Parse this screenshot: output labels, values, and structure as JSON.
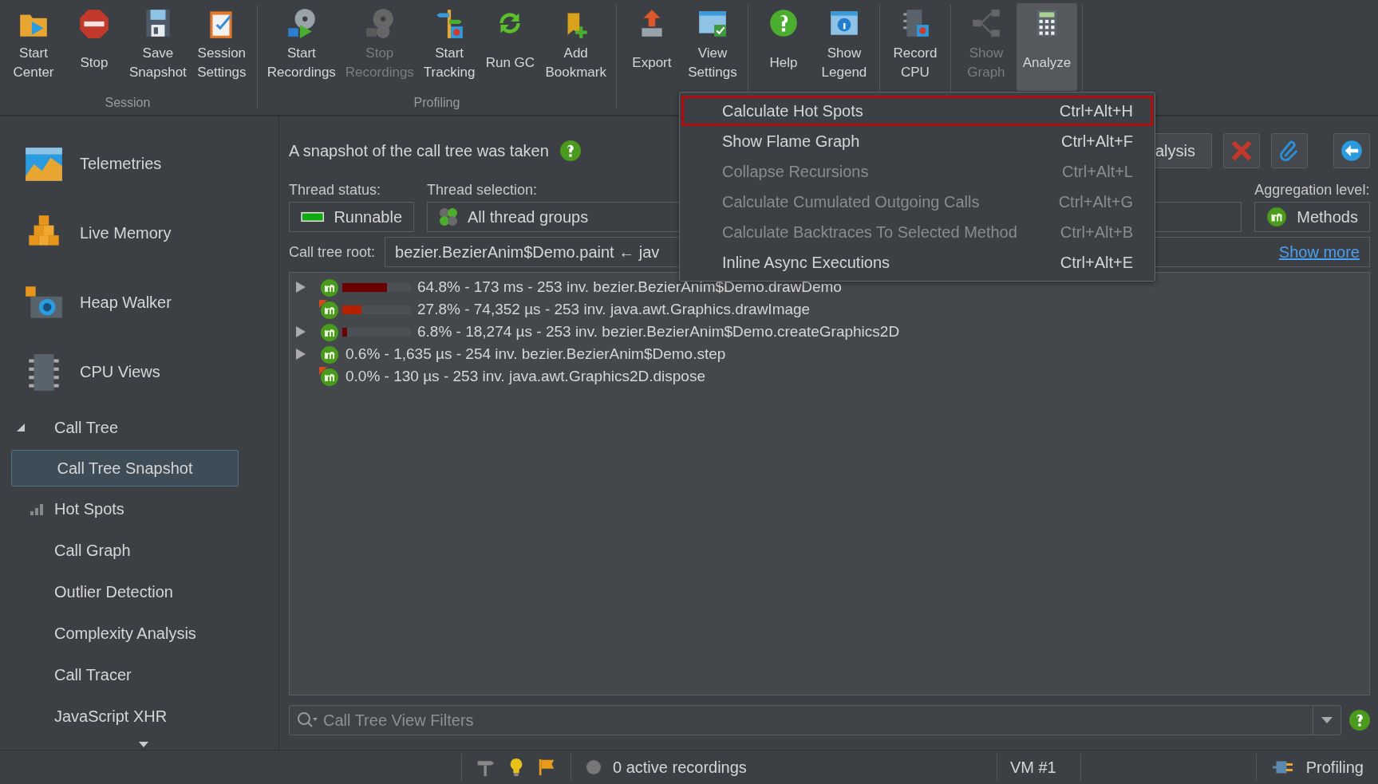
{
  "toolbar": {
    "groups": [
      {
        "label": "Session",
        "buttons": [
          {
            "lines": [
              "Start",
              "Center"
            ],
            "disabled": false,
            "pressed": false
          },
          {
            "lines": [
              "Stop"
            ],
            "disabled": false,
            "pressed": false
          },
          {
            "lines": [
              "Save",
              "Snapshot"
            ],
            "disabled": false,
            "pressed": false
          },
          {
            "lines": [
              "Session",
              "Settings"
            ],
            "disabled": false,
            "pressed": false
          }
        ]
      },
      {
        "label": "Profiling",
        "buttons": [
          {
            "lines": [
              "Start",
              "Recordings"
            ],
            "disabled": false,
            "pressed": false
          },
          {
            "lines": [
              "Stop",
              "Recordings"
            ],
            "disabled": true,
            "pressed": false
          },
          {
            "lines": [
              "Start",
              "Tracking"
            ],
            "disabled": false,
            "pressed": false
          },
          {
            "lines": [
              "Run GC"
            ],
            "disabled": false,
            "pressed": false
          },
          {
            "lines": [
              "Add",
              "Bookmark"
            ],
            "disabled": false,
            "pressed": false
          }
        ]
      },
      {
        "buttons": [
          {
            "lines": [
              "Export"
            ],
            "disabled": false,
            "pressed": false
          },
          {
            "lines": [
              "View",
              "Settings"
            ],
            "disabled": false,
            "pressed": false
          }
        ]
      },
      {
        "buttons": [
          {
            "lines": [
              "Help"
            ],
            "disabled": false,
            "pressed": false
          },
          {
            "lines": [
              "Show",
              "Legend"
            ],
            "disabled": false,
            "pressed": false
          }
        ]
      },
      {
        "buttons": [
          {
            "lines": [
              "Record",
              "CPU"
            ],
            "disabled": false,
            "pressed": false
          }
        ]
      },
      {
        "buttons": [
          {
            "lines": [
              "Show",
              "Graph"
            ],
            "disabled": true,
            "pressed": false
          },
          {
            "lines": [
              "Analyze"
            ],
            "disabled": false,
            "pressed": true
          }
        ]
      }
    ]
  },
  "sidebar": {
    "sections": [
      {
        "label": "Telemetries"
      },
      {
        "label": "Live Memory"
      },
      {
        "label": "Heap Walker"
      },
      {
        "label": "CPU Views"
      }
    ],
    "views": [
      {
        "label": "Call Tree",
        "selected": false,
        "expanded": true,
        "children": [
          {
            "label": "Call Tree Snapshot",
            "selected": true
          }
        ]
      },
      {
        "label": "Hot Spots",
        "selected": false
      },
      {
        "label": "Call Graph",
        "selected": false
      },
      {
        "label": "Outlier Detection",
        "selected": false
      },
      {
        "label": "Complexity Analysis",
        "selected": false
      },
      {
        "label": "Call Tracer",
        "selected": false
      },
      {
        "label": "JavaScript XHR",
        "selected": false
      }
    ]
  },
  "main": {
    "message": "A snapshot of the call tree was taken",
    "analysis_button": "alysis",
    "thread_status": {
      "label": "Thread status:",
      "value": "Runnable"
    },
    "thread_selection": {
      "label": "Thread selection:",
      "value": "All thread groups"
    },
    "aggregation": {
      "label": "Aggregation level:",
      "value": "Methods"
    },
    "call_tree_root": {
      "label": "Call tree root:",
      "value": "bezier.BezierAnim$Demo.paint ← jav",
      "link": "Show more"
    },
    "rows": [
      {
        "text": "64.8% - 173 ms - 253 inv. bezier.BezierAnim$Demo.drawDemo",
        "collapsed": true,
        "marked": false,
        "level": 0.648,
        "color": "#6b0000"
      },
      {
        "text": "27.8% - 74,352 µs - 253 inv. java.awt.Graphics.drawImage",
        "collapsed": false,
        "marked": true,
        "level": 0.278,
        "color": "#b52000"
      },
      {
        "text": "6.8% - 18,274 µs - 253 inv. bezier.BezierAnim$Demo.createGraphics2D",
        "collapsed": true,
        "marked": false,
        "level": 0.068,
        "color": "#6b0000"
      },
      {
        "text": "0.6% - 1,635 µs - 254 inv. bezier.BezierAnim$Demo.step",
        "collapsed": true,
        "marked": false
      },
      {
        "text": "0.0% - 130 µs - 253 inv. java.awt.Graphics2D.dispose",
        "collapsed": false,
        "marked": true
      }
    ],
    "filter": {
      "placeholder": "Call Tree View Filters"
    }
  },
  "menu": [
    {
      "label": "Calculate Hot Spots",
      "shortcut": "Ctrl+Alt+H",
      "disabled": false,
      "selected": true
    },
    {
      "label": "Show Flame Graph",
      "shortcut": "Ctrl+Alt+F",
      "disabled": false,
      "selected": false
    },
    {
      "label": "Collapse Recursions",
      "shortcut": "Ctrl+Alt+L",
      "disabled": true,
      "selected": false
    },
    {
      "label": "Calculate Cumulated Outgoing Calls",
      "shortcut": "Ctrl+Alt+G",
      "disabled": true,
      "selected": false
    },
    {
      "label": "Calculate Backtraces To Selected Method",
      "shortcut": "Ctrl+Alt+B",
      "disabled": true,
      "selected": false
    },
    {
      "label": "Inline Async Executions",
      "shortcut": "Ctrl+Alt+E",
      "disabled": false,
      "selected": false
    }
  ],
  "status_bar": {
    "recordings": "0 active recordings",
    "vm": "VM #1",
    "mode": "Profiling"
  }
}
